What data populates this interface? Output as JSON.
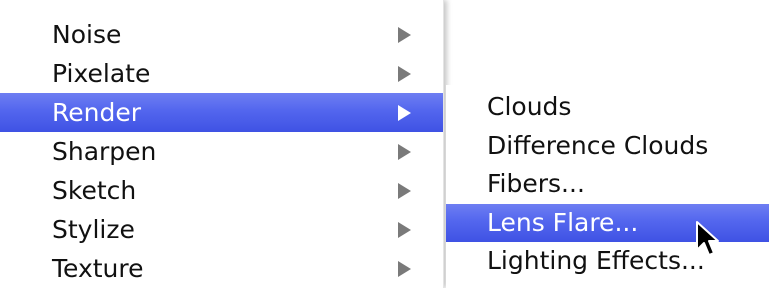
{
  "main_menu": {
    "items": [
      {
        "label": "Noise",
        "has_submenu": true,
        "highlighted": false
      },
      {
        "label": "Pixelate",
        "has_submenu": true,
        "highlighted": false
      },
      {
        "label": "Render",
        "has_submenu": true,
        "highlighted": true
      },
      {
        "label": "Sharpen",
        "has_submenu": true,
        "highlighted": false
      },
      {
        "label": "Sketch",
        "has_submenu": true,
        "highlighted": false
      },
      {
        "label": "Stylize",
        "has_submenu": true,
        "highlighted": false
      },
      {
        "label": "Texture",
        "has_submenu": true,
        "highlighted": false
      }
    ]
  },
  "sub_menu": {
    "items": [
      {
        "label": "Clouds",
        "highlighted": false
      },
      {
        "label": "Difference Clouds",
        "highlighted": false
      },
      {
        "label": "Fibers...",
        "highlighted": false
      },
      {
        "label": "Lens Flare...",
        "highlighted": true
      },
      {
        "label": "Lighting Effects...",
        "highlighted": false
      }
    ]
  },
  "colors": {
    "highlight": "#5366ee",
    "text": "#111111",
    "highlight_text": "#ffffff",
    "arrow": "#7a7a7a"
  },
  "icons": {
    "submenu_arrow": "submenu-arrow-icon",
    "pointer": "mouse-pointer-icon"
  }
}
